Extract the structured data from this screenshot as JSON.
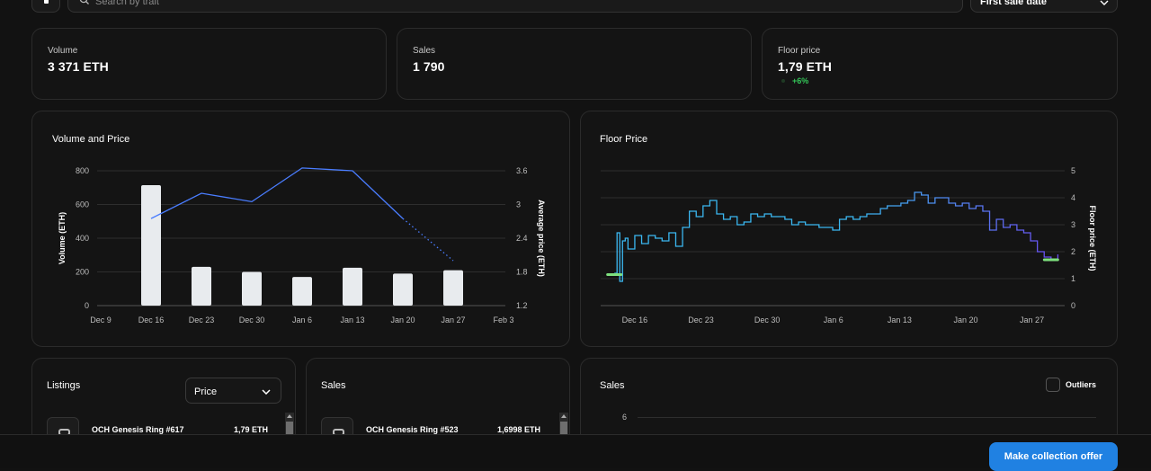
{
  "toolbar": {
    "search_placeholder": "Search by trait",
    "sort_value": "First sale date"
  },
  "stats": [
    {
      "label": "Volume",
      "value": "3 371 ETH"
    },
    {
      "label": "Sales",
      "value": "1 790"
    },
    {
      "label": "Floor price",
      "value": "1,79 ETH",
      "change": "+6%"
    }
  ],
  "volume_chart": {
    "title": "Volume and Price",
    "left_axis_title": "Volume (ETH)",
    "right_axis_title": "Average price (ETH)",
    "bar_color": "#e8ebee",
    "line_color": "#4a7dff"
  },
  "floor_chart": {
    "title": "Floor Price",
    "right_axis_title": "Floor price (ETH)",
    "line_color_start": "#3ab7f0",
    "line_color_end": "#6b4cf0",
    "marker_color": "#7ee07e"
  },
  "chart_data": [
    {
      "type": "bar",
      "title": "Volume and Price",
      "xlabel": "",
      "ylabel": "Volume (ETH)",
      "y2label": "Average price (ETH)",
      "x_ticks": [
        "Dec 9",
        "Dec 16",
        "Dec 23",
        "Dec 30",
        "Jan 6",
        "Jan 13",
        "Jan 20",
        "Jan 27",
        "Feb 3"
      ],
      "ylim": [
        0,
        800
      ],
      "y_ticks": [
        "0",
        "200",
        "400",
        "600",
        "800"
      ],
      "y2lim": [
        1.2,
        3.6
      ],
      "y2_ticks": [
        "1.2",
        "1.8",
        "2.4",
        "3",
        "3.6"
      ],
      "categories": [
        "Dec 16",
        "Dec 23",
        "Dec 30",
        "Jan 6",
        "Jan 13",
        "Jan 20",
        "Jan 27"
      ],
      "series": [
        {
          "values": [
            715,
            230,
            200,
            170,
            225,
            190,
            210
          ]
        },
        {
          "values": [
            2.75,
            3.2,
            3.05,
            3.65,
            3.6,
            2.75,
            2.0
          ]
        }
      ],
      "grid": true
    },
    {
      "type": "line",
      "title": "Floor Price",
      "ylabel": "Floor price (ETH)",
      "x_ticks": [
        "Dec 16",
        "Dec 23",
        "Dec 30",
        "Jan 6",
        "Jan 13",
        "Jan 20",
        "Jan 27"
      ],
      "ylim": [
        0,
        5
      ],
      "y_ticks": [
        "0",
        "1",
        "2",
        "3",
        "4",
        "5"
      ],
      "x_days": [
        0,
        0.4,
        0.8,
        1.2,
        1.6,
        2,
        3,
        4,
        5,
        6,
        7,
        8,
        9,
        10,
        11,
        12,
        13,
        14,
        15,
        16,
        17,
        18,
        19,
        20,
        21,
        22,
        23,
        24,
        25,
        26,
        27,
        28,
        29,
        30,
        31,
        32,
        33,
        34,
        35,
        36,
        37,
        38,
        39,
        40,
        41,
        42,
        43,
        44,
        45,
        46,
        47,
        48,
        49,
        50,
        51,
        52,
        53,
        54,
        55,
        56,
        57,
        58,
        59,
        60,
        61,
        62,
        63,
        64,
        65
      ],
      "values": [
        1.2,
        2.7,
        0.9,
        2.4,
        2.5,
        2.1,
        2.6,
        2.3,
        2.6,
        2.5,
        2.4,
        2.7,
        2.2,
        2.9,
        3.5,
        3.3,
        3.7,
        3.9,
        3.4,
        3.2,
        3.3,
        3.0,
        3.1,
        3.4,
        3.3,
        3.4,
        3.3,
        3.3,
        3.2,
        3.0,
        3.1,
        3.0,
        3.0,
        2.9,
        2.9,
        2.8,
        3.2,
        3.3,
        3.2,
        3.3,
        3.4,
        3.4,
        3.6,
        3.7,
        3.7,
        3.8,
        3.9,
        4.2,
        4.1,
        3.8,
        4.0,
        4.0,
        3.8,
        3.7,
        3.8,
        3.6,
        3.7,
        3.5,
        2.8,
        3.2,
        2.9,
        3.0,
        2.8,
        2.7,
        2.4,
        2.0,
        1.8,
        1.7,
        1.9
      ],
      "markers": [
        {
          "x_day": 0,
          "value": 1.15
        },
        {
          "x_day": 64,
          "value": 1.7
        }
      ]
    }
  ],
  "listings": {
    "title": "Listings",
    "sort_value": "Price",
    "items": [
      {
        "name": "OCH Genesis Ring #617",
        "price": "1,79 ETH"
      }
    ]
  },
  "sales_list": {
    "title": "Sales",
    "items": [
      {
        "name": "OCH Genesis Ring #523",
        "price": "1,6998 ETH"
      }
    ]
  },
  "sales_chart": {
    "title": "Sales",
    "outliers_label": "Outliers",
    "y_tick_top": "6"
  },
  "footer": {
    "cta_label": "Make collection offer"
  }
}
